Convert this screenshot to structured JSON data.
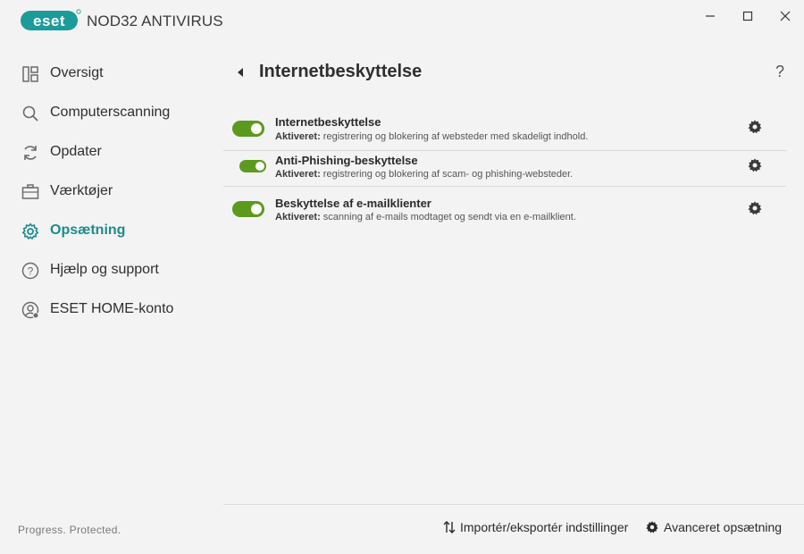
{
  "app": {
    "brand": "eset",
    "product_name": "NOD32 ANTIVIRUS",
    "tagline": "Progress. Protected."
  },
  "window_controls": {
    "minimize_icon": "minimize-icon",
    "maximize_icon": "maximize-icon",
    "close_icon": "close-icon"
  },
  "colors": {
    "accent": "#1b8c8a",
    "toggle_on": "#5c9a1e",
    "brand_teal": "#1b9b9a"
  },
  "sidebar": {
    "items": [
      {
        "label": "Oversigt",
        "icon": "dashboard-icon",
        "active": false
      },
      {
        "label": "Computerscanning",
        "icon": "search-icon",
        "active": false
      },
      {
        "label": "Opdater",
        "icon": "refresh-icon",
        "active": false
      },
      {
        "label": "Værktøjer",
        "icon": "briefcase-icon",
        "active": false
      },
      {
        "label": "Opsætning",
        "icon": "gear-icon",
        "active": true
      },
      {
        "label": "Hjælp og support",
        "icon": "help-circle-icon",
        "active": false
      },
      {
        "label": "ESET HOME-konto",
        "icon": "account-icon",
        "active": false
      }
    ]
  },
  "main": {
    "title": "Internetbeskyttelse",
    "help": "?",
    "rows": [
      {
        "title": "Internetbeskyttelse",
        "status": "Aktiveret:",
        "description": " registrering og blokering af websteder med skadeligt indhold.",
        "enabled": true
      },
      {
        "title": "Anti-Phishing-beskyttelse",
        "status": "Aktiveret:",
        "description": " registrering og blokering af scam- og phishing-websteder.",
        "enabled": true
      },
      {
        "title": "Beskyttelse af e-mailklienter",
        "status": "Aktiveret:",
        "description": " scanning af e-mails modtaget og sendt via en e-mailklient.",
        "enabled": true
      }
    ]
  },
  "footer": {
    "import_export_label": "Importér/eksportér indstillinger",
    "advanced_setup_label": "Avanceret opsætning"
  }
}
